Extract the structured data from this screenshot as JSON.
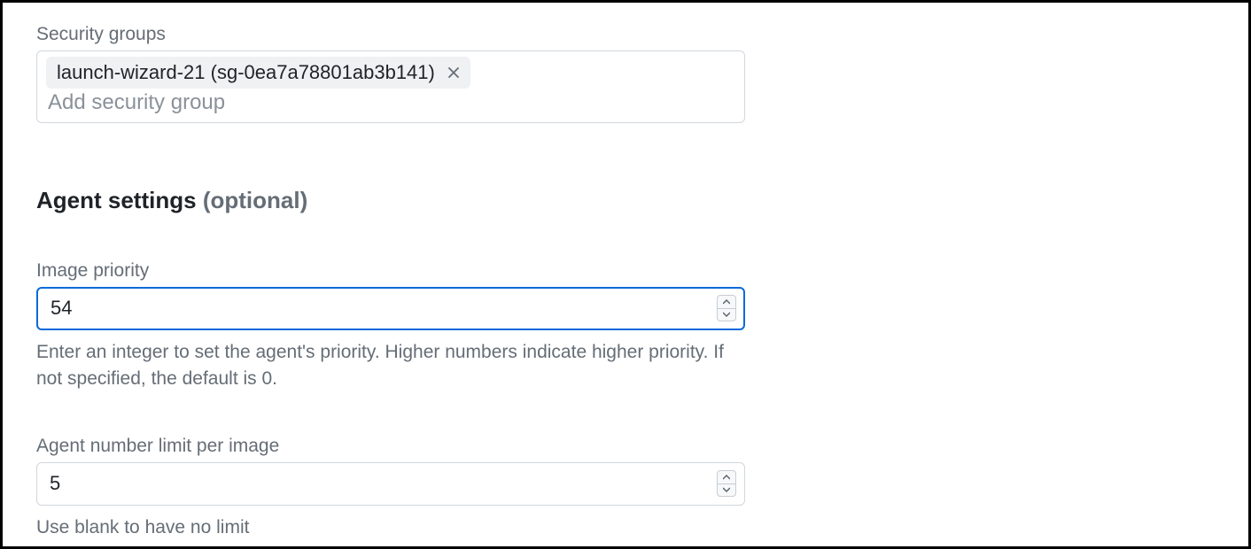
{
  "security_groups": {
    "label": "Security groups",
    "chip": "launch-wizard-21 (sg-0ea7a78801ab3b141)",
    "placeholder": "Add security group"
  },
  "agent_settings": {
    "heading": "Agent settings",
    "optional": "(optional)",
    "image_priority": {
      "label": "Image priority",
      "value": "54",
      "help": "Enter an integer to set the agent's priority. Higher numbers indicate higher priority. If not specified, the default is 0."
    },
    "agent_limit": {
      "label": "Agent number limit per image",
      "value": "5",
      "help": "Use blank to have no limit"
    }
  }
}
